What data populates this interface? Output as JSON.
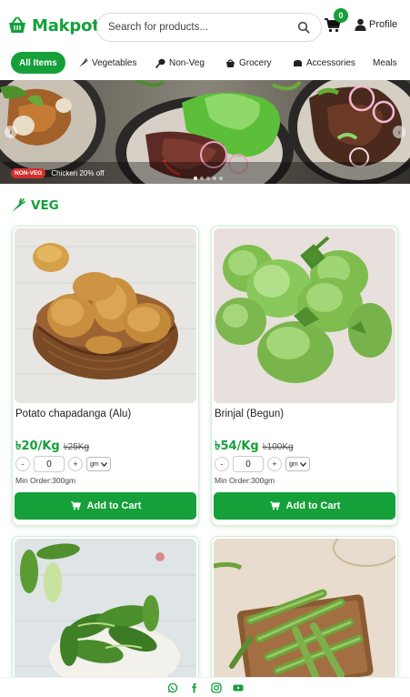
{
  "brand": {
    "name": "Makpot",
    "color": "#15a03a"
  },
  "search": {
    "placeholder": "Search for products..."
  },
  "cart": {
    "count": "0"
  },
  "profile": {
    "label": "Profile"
  },
  "categories": [
    {
      "label": "All Items",
      "icon": "none"
    },
    {
      "label": "Vegetables",
      "icon": "carrot-icon"
    },
    {
      "label": "Non-Veg",
      "icon": "drumstick-icon"
    },
    {
      "label": "Grocery",
      "icon": "basket-icon"
    },
    {
      "label": "Accessories",
      "icon": "bread-icon"
    },
    {
      "label": "Meals",
      "icon": "none"
    }
  ],
  "banner": {
    "tag": "NON-VEG",
    "text": "Chicken 20% off",
    "slides": 5,
    "active_slide": 1
  },
  "section": {
    "title": "VEG"
  },
  "products": [
    {
      "name": "Potato chapadanga (Alu)",
      "price": "৳20/Kg",
      "old_price": "৳25Kg",
      "qty": "0",
      "unit": "gm",
      "min_order": "Min Order:300gm",
      "cta": "Add to Cart"
    },
    {
      "name": "Brinjal (Begun)",
      "price": "৳54/Kg",
      "old_price": "৳100Kg",
      "qty": "0",
      "unit": "gm",
      "min_order": "Min Order:300gm",
      "cta": "Add to Cart"
    },
    {
      "name": "",
      "price": "",
      "old_price": "",
      "qty": "",
      "unit": "",
      "min_order": "",
      "cta": ""
    },
    {
      "name": "",
      "price": "",
      "old_price": "",
      "qty": "",
      "unit": "",
      "min_order": "",
      "cta": ""
    }
  ],
  "footer": {
    "icons": [
      "whatsapp-icon",
      "facebook-icon",
      "instagram-icon",
      "youtube-icon"
    ]
  }
}
